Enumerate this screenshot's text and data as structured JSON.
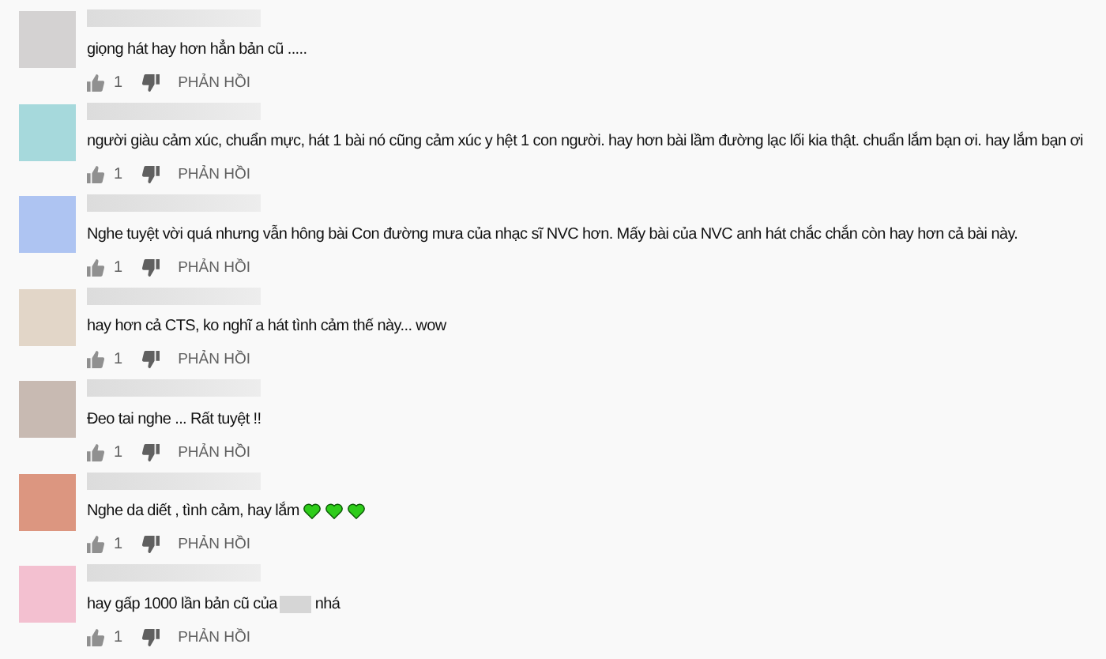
{
  "comments": [
    {
      "color": "#d4d2d2",
      "text": "giọng hát hay hơn hẳn bản cũ .....",
      "likes": "1",
      "reply": "PHẢN HỒI"
    },
    {
      "color": "#a6d9dc",
      "text": "người giàu cảm xúc, chuẩn mực, hát 1 bài nó cũng cảm xúc y hệt 1 con người. hay hơn bài lầm đường lạc lối kia thật. chuẩn lắm bạn ơi. hay lắm bạn ơi",
      "likes": "1",
      "reply": "PHẢN HỒI"
    },
    {
      "color": "#aec4f2",
      "text": "Nghe tuyệt vời quá nhưng vẫn hông bài Con đường mưa của nhạc sĩ NVC hơn. Mấy bài của NVC anh hát chắc chắn còn hay hơn cả bài này.",
      "likes": "1",
      "reply": "PHẢN HỒI"
    },
    {
      "color": "#e2d6c8",
      "text": "hay hơn cả CTS, ko nghĩ a hát tình cảm thế này... wow",
      "likes": "1",
      "reply": "PHẢN HỒI"
    },
    {
      "color": "#c8bab2",
      "text": "Đeo tai nghe ... Rất tuyệt !!",
      "likes": "1",
      "reply": "PHẢN HỒI"
    },
    {
      "color": "#dc9680",
      "text": "Nghe da diết , tình cảm, hay lắm",
      "icons": [
        {
          "kind": "heart"
        },
        {
          "kind": "heart"
        },
        {
          "kind": "heart"
        }
      ],
      "likes": "1",
      "reply": "PHẢN HỒI"
    },
    {
      "color": "#f3c0d0",
      "text": "hay gấp 1000 lần bản cũ của",
      "text_after": "nhá",
      "likes": "1",
      "reply": "PHẢN HỒI"
    }
  ]
}
